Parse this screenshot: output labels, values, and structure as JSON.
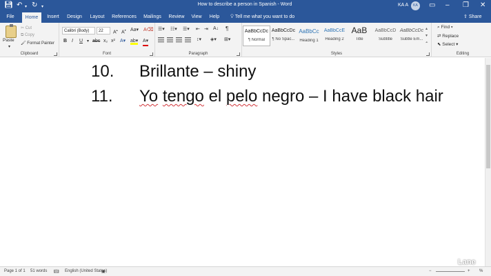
{
  "window": {
    "title": "How to describe a person in Spanish - Word",
    "user": "KA A",
    "avatar": "KA"
  },
  "quick_access": [
    "save-icon",
    "undo-icon",
    "redo-icon",
    "customize-icon"
  ],
  "tabs": [
    "File",
    "Home",
    "Insert",
    "Design",
    "Layout",
    "References",
    "Mailings",
    "Review",
    "View",
    "Help"
  ],
  "tell_me": "Tell me what you want to do",
  "share": "Share",
  "clipboard": {
    "paste": "Paste",
    "cut": "Cut",
    "copy": "Copy",
    "format_painter": "Format Painter",
    "label": "Clipboard"
  },
  "font": {
    "family": "Calibri (Body)",
    "size": "22",
    "label": "Font",
    "bold": "B",
    "italic": "I",
    "underline": "U"
  },
  "paragraph": {
    "label": "Paragraph",
    "pilcrow": "¶"
  },
  "styles": {
    "label": "Styles",
    "items": [
      {
        "sample": "AaBbCcDc",
        "name": "¶ Normal"
      },
      {
        "sample": "AaBbCcDc",
        "name": "¶ No Spac..."
      },
      {
        "sample": "AaBbCc",
        "name": "Heading 1"
      },
      {
        "sample": "AaBbCcE",
        "name": "Heading 2"
      },
      {
        "sample": "AaB",
        "name": "Title"
      },
      {
        "sample": "AaBbCcD",
        "name": "Subtitle"
      },
      {
        "sample": "AaBbCcDc",
        "name": "Subtle Em..."
      }
    ]
  },
  "editing": {
    "find": "Find",
    "replace": "Replace",
    "select": "Select",
    "label": "Editing"
  },
  "document": {
    "lines": [
      {
        "num": "10.",
        "words": [
          "Brillante – shiny"
        ]
      },
      {
        "num": "11.",
        "words": [
          "Yo",
          "tengo",
          "el",
          "pelo",
          "negro – I have black hair"
        ]
      }
    ]
  },
  "status": {
    "page": "Page 1 of 1",
    "words": "51 words",
    "language": "English (United States)",
    "zoom": "%"
  },
  "watermark": "Lane",
  "colors": {
    "accent": "#2b579a",
    "ribbon": "#f3f3f3",
    "spell": "#d13438"
  }
}
